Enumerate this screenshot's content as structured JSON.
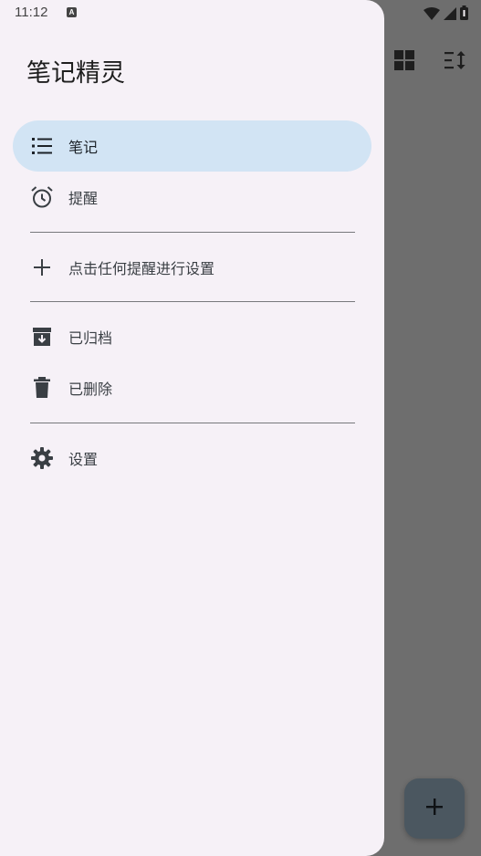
{
  "status_bar": {
    "time": "11:12",
    "notification_glyph": "A"
  },
  "app_background": {
    "toolbar_icons": [
      "grid-view-icon",
      "sort-icon"
    ],
    "fab_icon": "add-icon"
  },
  "drawer": {
    "title": "笔记精灵",
    "items": [
      {
        "label": "笔记",
        "icon": "list-icon",
        "active": true
      },
      {
        "label": "提醒",
        "icon": "alarm-icon",
        "active": false
      },
      {
        "label": "点击任何提醒进行设置",
        "icon": "add-icon",
        "active": false
      },
      {
        "label": "已归档",
        "icon": "archive-icon",
        "active": false
      },
      {
        "label": "已删除",
        "icon": "trash-icon",
        "active": false
      },
      {
        "label": "设置",
        "icon": "gear-icon",
        "active": false
      }
    ]
  },
  "colors": {
    "drawer_bg": "#f6f1f7",
    "active_item_bg": "#d2e4f4",
    "scrim": "#6e6e6e",
    "fab_bg": "#4b5760"
  }
}
